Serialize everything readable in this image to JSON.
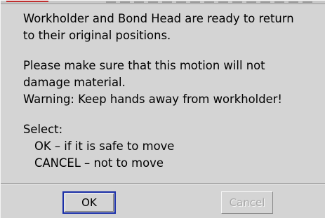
{
  "message": {
    "line1": "Workholder and Bond Head are ready to return",
    "line2": "to their original positions.",
    "line3": "Please make sure that this motion will not",
    "line4": "damage material.",
    "line5": "Warning: Keep hands away from workholder!",
    "line6": "Select:",
    "line7": "OK – if it is safe to move",
    "line8": "CANCEL – not to move"
  },
  "buttons": {
    "ok_label": "OK",
    "cancel_label": "Cancel",
    "cancel_disabled": true
  },
  "colors": {
    "dialog_bg": "#d4d4d4",
    "focus_border": "#1a2fa8",
    "disabled_text": "#a8a8a8"
  }
}
